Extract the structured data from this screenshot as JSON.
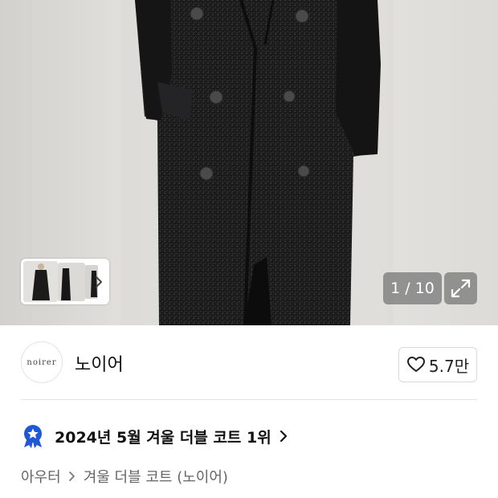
{
  "gallery": {
    "counter": "1 / 10"
  },
  "brand": {
    "logo_text": "noirer",
    "name": "노이어",
    "likes": "5.7만"
  },
  "ranking": {
    "text": "2024년 5월 겨울 더블 코트 1위"
  },
  "breadcrumb": {
    "category": "아우터",
    "subcategory": "겨울 더블 코트 (노이어)"
  },
  "colors": {
    "coat": "#1c1b1c",
    "badge": "#1f57d6",
    "overlay": "#808080"
  },
  "icons": [
    "chevron-right-icon",
    "expand-icon",
    "heart-icon",
    "ranking-badge-icon"
  ]
}
